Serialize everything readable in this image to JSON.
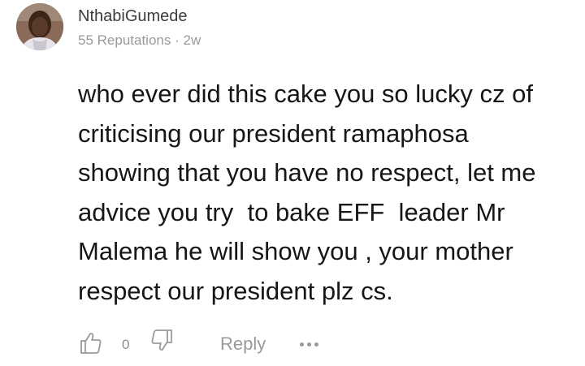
{
  "comment": {
    "author": "NthabiGumede",
    "reputation_text": "55 Reputations",
    "separator": " · ",
    "age": "2w",
    "body_lines": [
      "who ever did this cake you so lucky cz of",
      "criticising our president ramaphosa",
      "showing that you have no respect, let me",
      "advice you try  to bake EFF  leader Mr",
      "Malema he will show you , your mother",
      "respect our president plz cs."
    ]
  },
  "actions": {
    "like_count": "0",
    "reply_label": "Reply",
    "like_icon": "thumbs-up-icon",
    "dislike_icon": "thumbs-down-icon",
    "more_icon": "more-dots-icon"
  },
  "colors": {
    "text": "#161616",
    "muted": "#9a9a9a",
    "author": "#3c3c3c"
  }
}
